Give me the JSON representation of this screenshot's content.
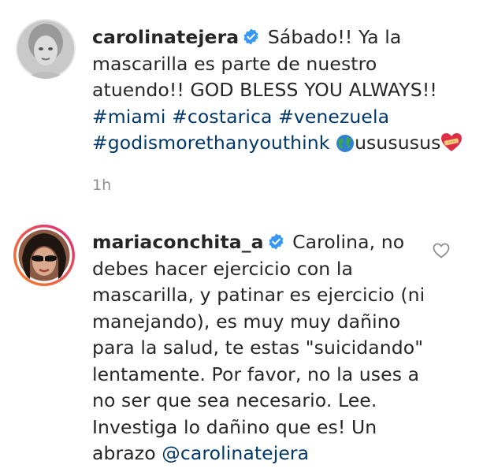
{
  "comments": [
    {
      "username": "carolinatejera",
      "verified": true,
      "text_line1": "Sábado!! Ya la",
      "text_line2": "mascarilla es parte de nuestro",
      "text_line3": "atuendo!! GOD BLESS YOU ALWAYS!!",
      "hashtags_line1": [
        "#miami",
        "#costarica",
        "#venezuela"
      ],
      "hashtag_line2": "#godismorethanyouthink",
      "emoji_globe": "globe-americas-icon",
      "text_after_globe": "usususus",
      "emoji_heart": "heart-with-bandage-icon",
      "timestamp": "1h"
    },
    {
      "username": "mariaconchita_a",
      "verified": true,
      "lines": [
        "Carolina, no",
        "debes hacer ejercicio con la",
        "mascarilla, y patinar es ejercicio (ni",
        "manejando), es muy muy dañino",
        "para la salud, te estas \"suicidando\"",
        "lentamente. Por favor, no la uses a",
        "no ser que sea necesario. Lee.",
        "Investiga lo dañino que es! Un",
        "abrazo "
      ],
      "mention": "@carolinatejera",
      "like_icon": "heart-outline-icon"
    }
  ],
  "colors": {
    "text": "#262626",
    "link": "#00376b",
    "muted": "#8e8e8e",
    "verified": "#3897f0",
    "story_ring_start": "#f58529",
    "story_ring_end": "#dd2a7b"
  }
}
